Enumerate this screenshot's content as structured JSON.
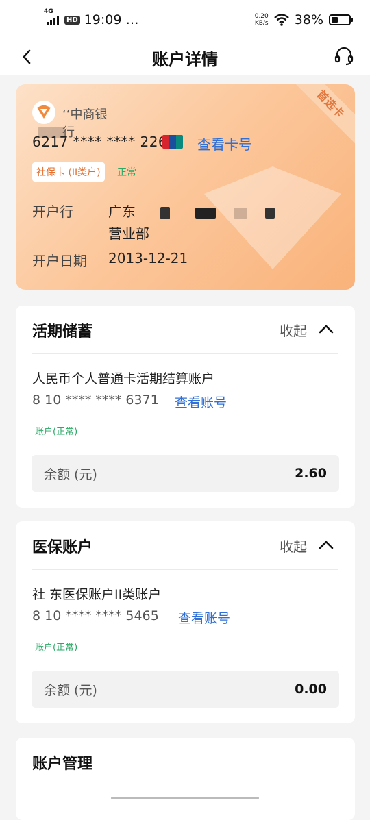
{
  "status_bar": {
    "network": "4G",
    "hd": "HD",
    "time": "19:09",
    "more": "…",
    "speed_value": "0.20",
    "speed_unit": "KB/s",
    "battery": "38%",
    "battery_level": 0.38
  },
  "nav": {
    "title": "账户详情"
  },
  "card": {
    "bank_name": "‘‘中商银行",
    "number": "6217 **** **** 2261",
    "view_number": "查看卡号",
    "ribbon": "首选卡",
    "tag": "社保卡 (II类户)",
    "status": "正常",
    "branch_label": "开户行",
    "branch_value_1": "广东",
    "branch_value_2": "营业部",
    "date_label": "开户日期",
    "date_value": "2013-12-21",
    "colors": {
      "link": "#2f6fd6",
      "accent": "#e46f2e",
      "status": "#2aa866"
    }
  },
  "savings": {
    "title": "活期储蓄",
    "collapse": "收起",
    "account_name": "人民币个人普通卡活期结算账户",
    "account_number": "8 10 **** **** 6371",
    "view_account": "查看账号",
    "status": "账户(正常)",
    "balance_label": "余额 (元)",
    "balance_value": "2.60"
  },
  "medical": {
    "title": "医保账户",
    "collapse": "收起",
    "account_name": "社 东医保账户II类账户",
    "account_number": "8 10 **** **** 5465",
    "view_account": "查看账号",
    "status": "账户(正常)",
    "balance_label": "余额 (元)",
    "balance_value": "0.00"
  },
  "management": {
    "title": "账户管理"
  }
}
